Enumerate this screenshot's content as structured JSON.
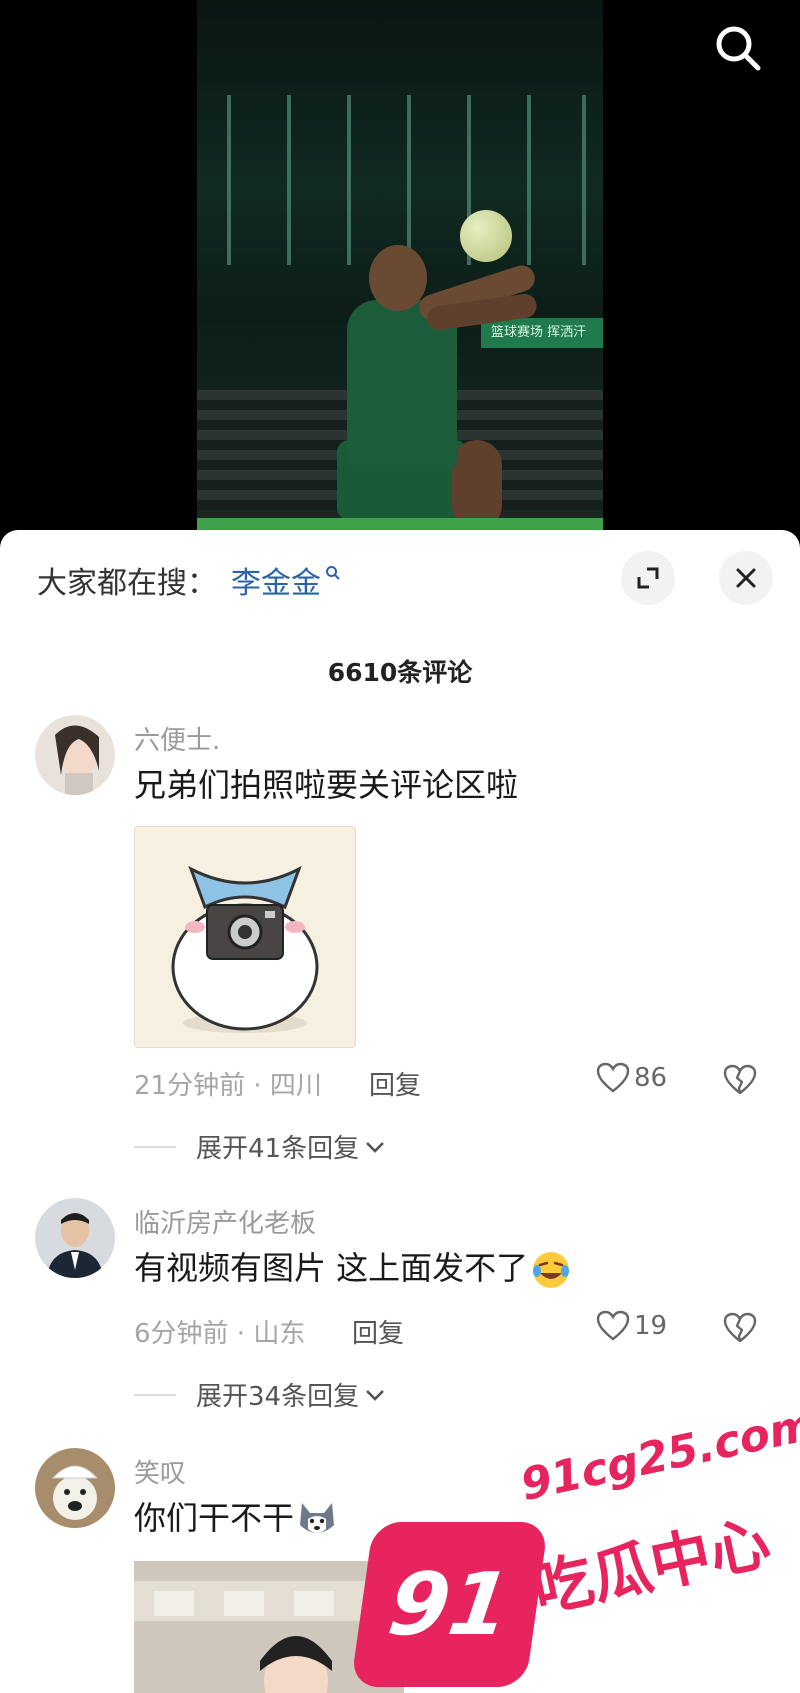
{
  "video": {
    "banner_text": "篮球赛场 挥洒汗"
  },
  "sheet": {
    "hot_search_label": "大家都在搜：",
    "hot_search_term": "李金金",
    "comment_count": "6610条评论"
  },
  "comments": [
    {
      "username": "六便士.",
      "text": "兄弟们拍照啦要关评论区啦",
      "time_location": "21分钟前 · 四川",
      "reply_label": "回复",
      "likes": "86",
      "expand_label": "展开41条回复"
    },
    {
      "username": "临沂房产化老板",
      "text": "有视频有图片 这上面发不了",
      "time_location": "6分钟前 · 山东",
      "reply_label": "回复",
      "likes": "19",
      "expand_label": "展开34条回复"
    },
    {
      "username": "笑叹",
      "text": "你们干不干"
    }
  ],
  "watermark": {
    "badge": "91",
    "domain": "91cg25.com",
    "title": "吃瓜中心"
  },
  "colors": {
    "link_blue": "#2a64a8",
    "watermark_pink": "#e8245f"
  }
}
